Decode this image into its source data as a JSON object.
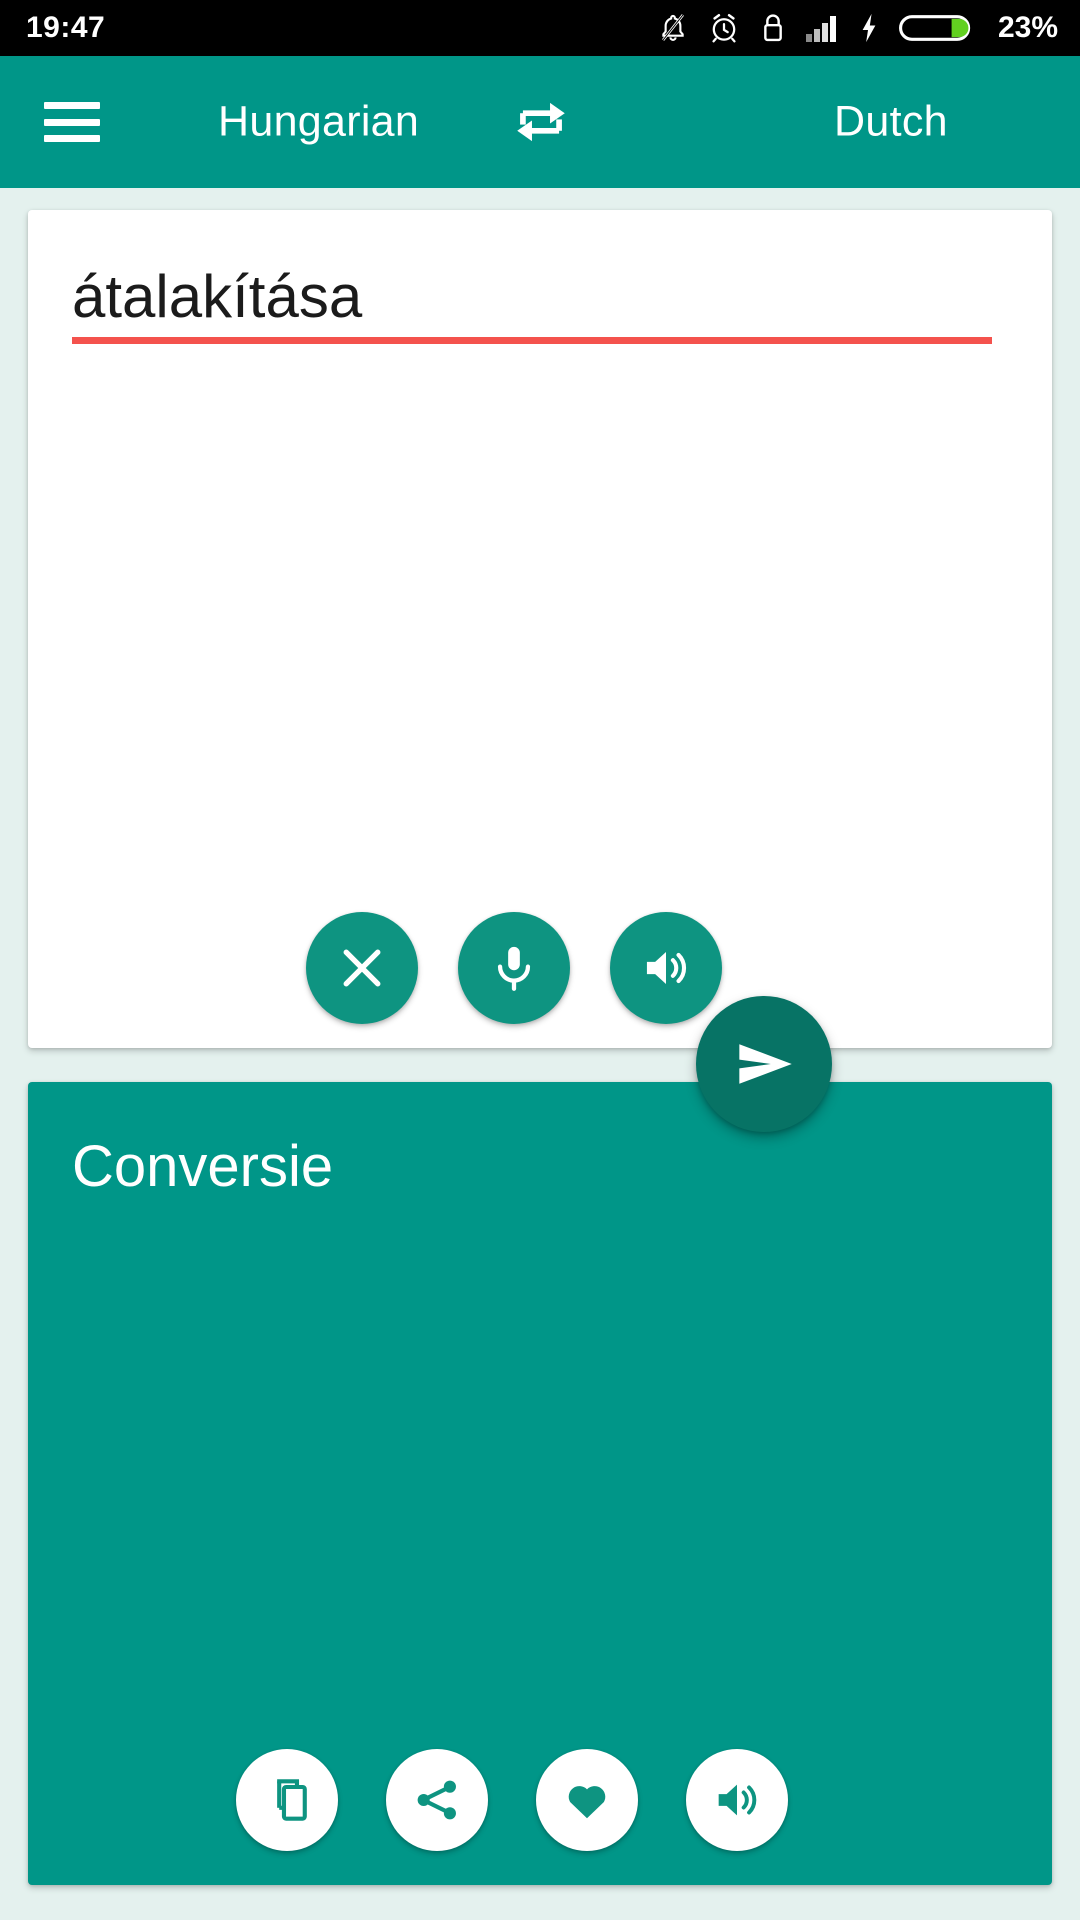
{
  "statusbar": {
    "time": "19:47",
    "battery_percent": "23%",
    "icons": [
      {
        "name": "notifications-off-icon"
      },
      {
        "name": "alarm-clock-icon"
      },
      {
        "name": "screen-lock-icon"
      },
      {
        "name": "signal-bars-icon"
      },
      {
        "name": "charging-bolt-icon"
      },
      {
        "name": "battery-icon"
      }
    ]
  },
  "appbar": {
    "menu_icon": "hamburger-menu-icon",
    "source_language": "Hungarian",
    "swap_icon": "swap-languages-icon",
    "target_language": "Dutch"
  },
  "source_card": {
    "text": "átalakítása",
    "spellcheck_underline": true,
    "actions": [
      {
        "name": "clear-button",
        "icon": "close-x-icon",
        "label": "Clear"
      },
      {
        "name": "voice-input-button",
        "icon": "microphone-icon",
        "label": "Voice input"
      },
      {
        "name": "speak-source-button",
        "icon": "speaker-icon",
        "label": "Listen"
      }
    ]
  },
  "send_button": {
    "name": "translate-send-button",
    "icon": "send-arrow-icon",
    "label": "Translate"
  },
  "target_card": {
    "text": "Conversie",
    "actions": [
      {
        "name": "copy-button",
        "icon": "copy-icon",
        "label": "Copy"
      },
      {
        "name": "share-button",
        "icon": "share-icon",
        "label": "Share"
      },
      {
        "name": "favorite-button",
        "icon": "heart-icon",
        "label": "Favorite"
      },
      {
        "name": "speak-target-button",
        "icon": "speaker-icon",
        "label": "Listen"
      }
    ]
  },
  "colors": {
    "primary_teal": "#009688",
    "dark_teal": "#077365",
    "button_teal": "#0e9481",
    "background_mint": "#e4f1ee",
    "spellcheck_red": "#f4524d",
    "statusbar_black": "#000000",
    "battery_green": "#62d020"
  }
}
